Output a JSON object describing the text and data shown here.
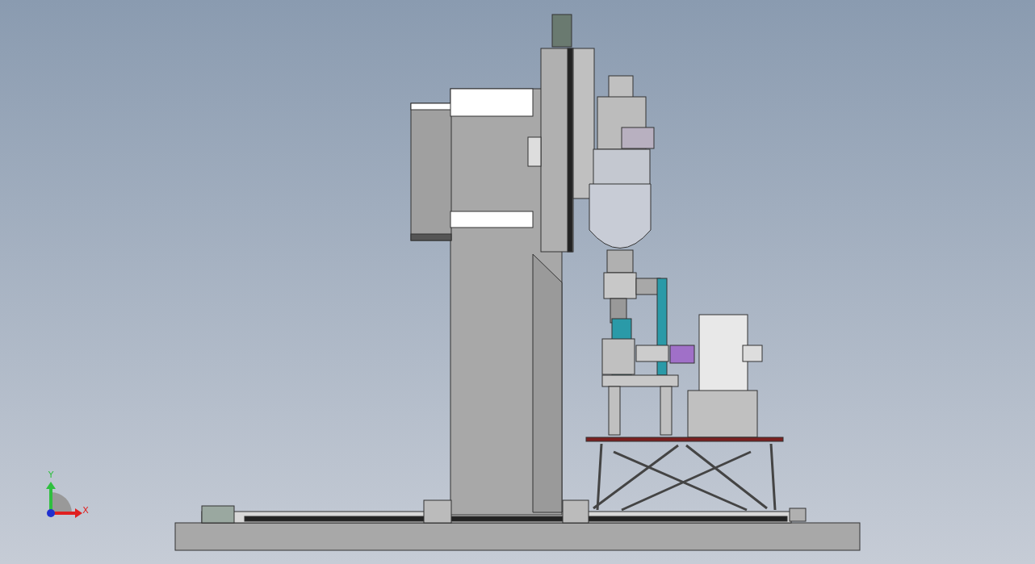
{
  "viewport": {
    "triad": {
      "axes": [
        {
          "kind": "y",
          "label": "Y"
        },
        {
          "kind": "x",
          "label": "X"
        }
      ]
    }
  }
}
